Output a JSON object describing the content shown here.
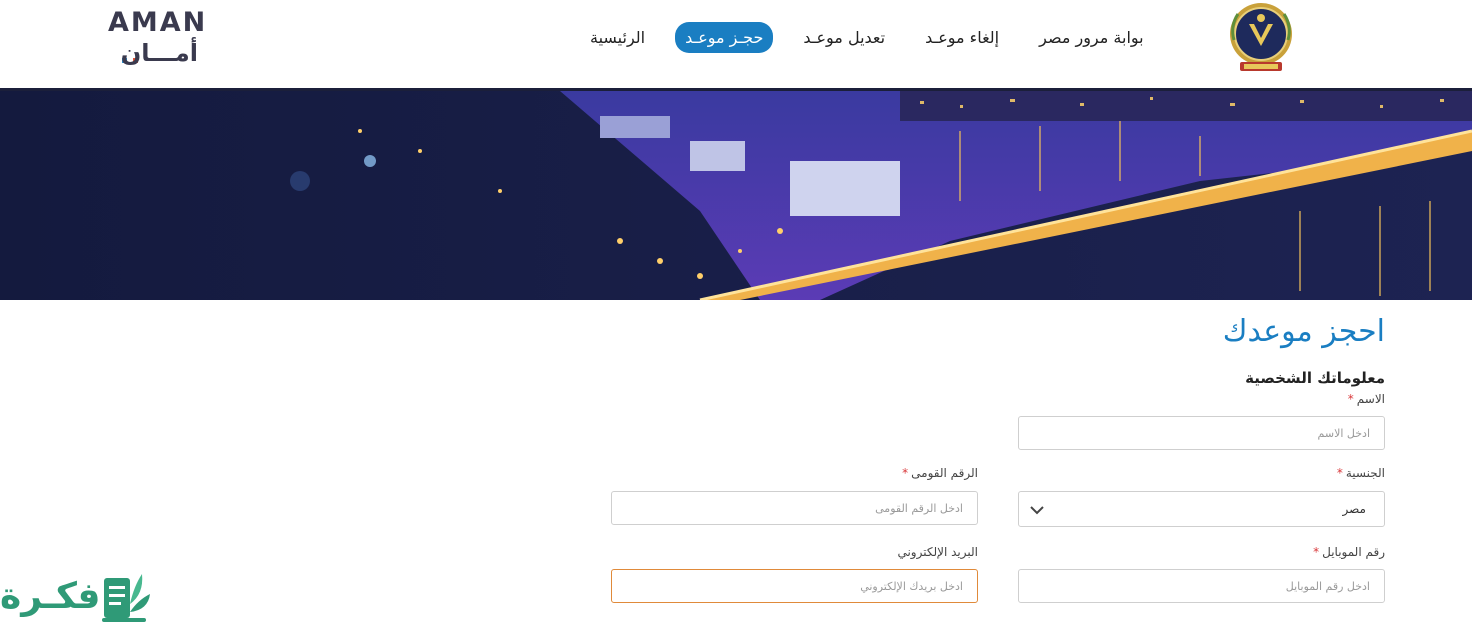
{
  "brand": {
    "en": "AMAN",
    "ar": "أمـــان"
  },
  "nav": {
    "items": [
      {
        "label": "الرئيسية"
      },
      {
        "label": "حجـز موعـد"
      },
      {
        "label": "تعديل موعـد"
      },
      {
        "label": "إلغاء موعـد"
      },
      {
        "label": "بوابة مرور مصر"
      }
    ],
    "active_index": 1
  },
  "icons": {
    "emblem": "police-emblem-icon",
    "select_chevron": "chevron-down-icon",
    "watermark_logo": "book-leaf-icon"
  },
  "colors": {
    "accent": "#1a7ec2",
    "required": "#d9373a",
    "focus_border": "#e08a3a",
    "header_border": "#1b1f3a",
    "watermark": "#2f9a77"
  },
  "form": {
    "title": "احجز موعدك",
    "section": "معلوماتك الشخصية",
    "required_mark": "*",
    "name": {
      "label": "الاسم",
      "placeholder": "ادخل الاسم",
      "value": ""
    },
    "nationality": {
      "label": "الجنسية",
      "value": "مصر"
    },
    "national_id": {
      "label": "الرقم القومى",
      "placeholder": "ادخل الرقم القومى",
      "value": ""
    },
    "mobile": {
      "label": "رقم الموبايل",
      "placeholder": "ادخل رقم الموبايل",
      "value": ""
    },
    "email": {
      "label": "البريد الإلكتروني",
      "placeholder": "ادخل بريدك الإلكتروني",
      "value": ""
    }
  },
  "watermark": {
    "text": "فكـرة"
  }
}
